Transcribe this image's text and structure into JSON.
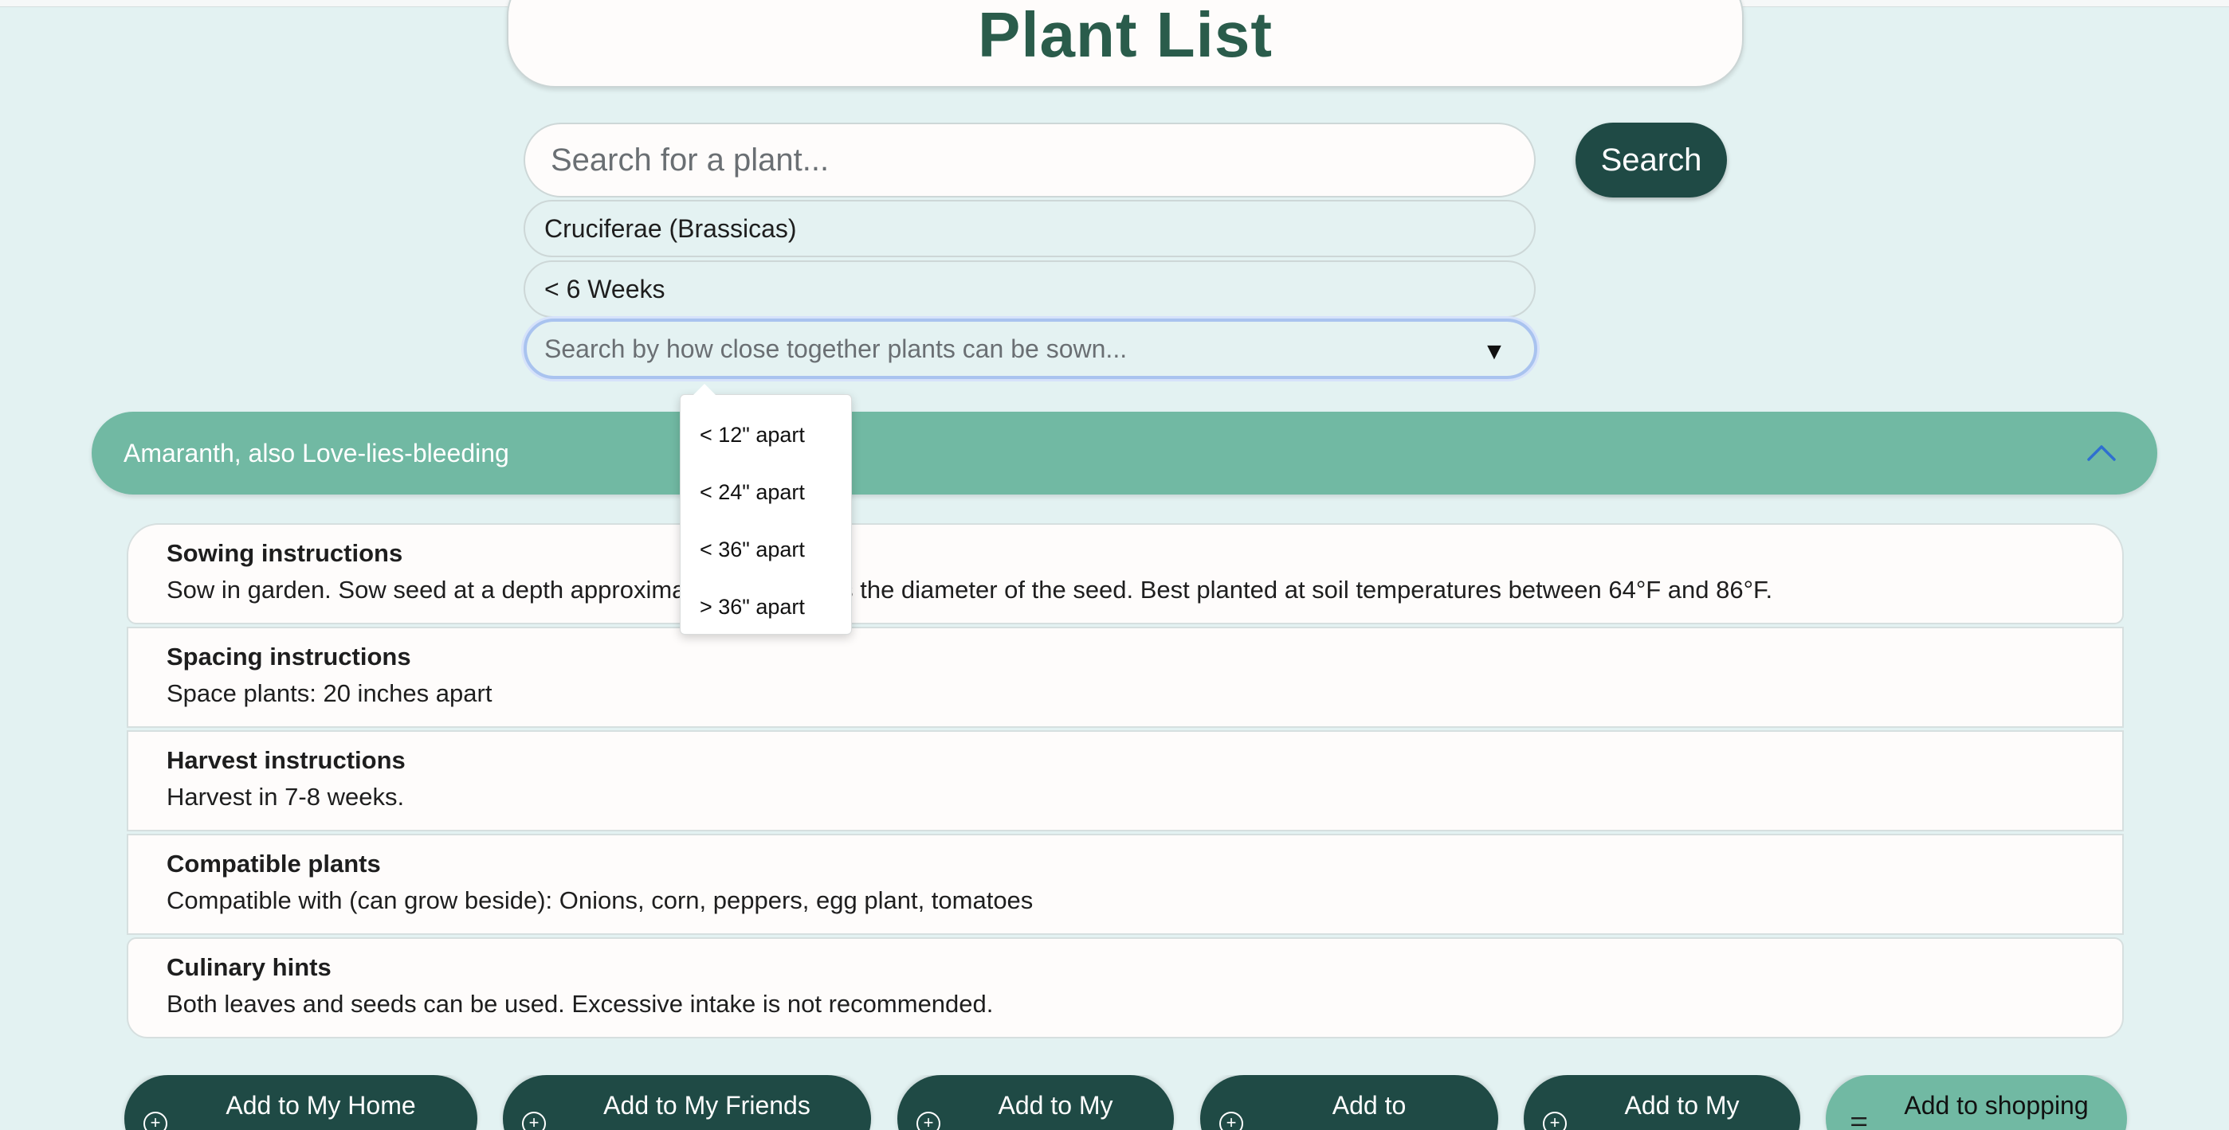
{
  "page": {
    "title": "Plant List"
  },
  "search": {
    "placeholder": "Search for a plant...",
    "button_label": "Search"
  },
  "filters": {
    "family": "Cruciferae (Brassicas)",
    "weeks": "< 6 Weeks",
    "spacing": {
      "placeholder": "Search by how close together plants can be sown...",
      "caret": "▼",
      "options": [
        "< 12\" apart",
        "< 24\" apart",
        "< 36\" apart",
        "> 36\" apart"
      ]
    }
  },
  "plant": {
    "name": "Amaranth, also Love-lies-bleeding",
    "sections": [
      {
        "heading": "Sowing instructions",
        "body": "Sow in garden. Sow seed at a depth approximately three times the diameter of the seed. Best planted at soil temperatures between 64°F and 86°F."
      },
      {
        "heading": "Spacing instructions",
        "body": "Space plants: 20 inches apart"
      },
      {
        "heading": "Harvest instructions",
        "body": "Harvest in 7-8 weeks."
      },
      {
        "heading": "Compatible plants",
        "body": "Compatible with (can grow beside): Onions, corn, peppers, egg plant, tomatoes"
      },
      {
        "heading": "Culinary hints",
        "body": "Both leaves and seeds can be used. Excessive intake is not recommended."
      }
    ]
  },
  "actions": {
    "add_home": "Add to My Home",
    "add_friends": "Add to My Friends",
    "add_my_1": "Add to My",
    "add_to": "Add to",
    "add_my_2": "Add to My",
    "add_shopping": "Add to shopping"
  },
  "icons": {
    "plus": "+",
    "list": "☰"
  },
  "colors": {
    "background": "#e3f2f2",
    "title_text": "#2a5c4b",
    "dark_button": "#1f4a45",
    "accordion": "#71b9a3",
    "card": "#fefcfb"
  }
}
